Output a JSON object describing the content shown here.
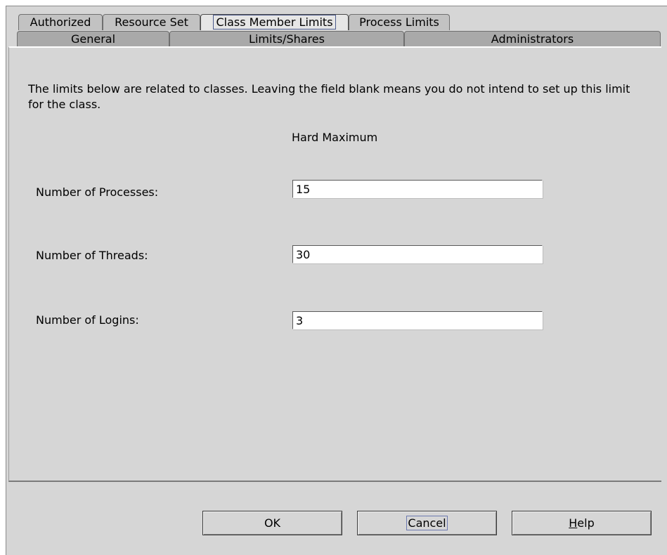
{
  "tabs_row1": [
    "Authorized",
    "Resource Set",
    "Class Member Limits",
    "Process Limits"
  ],
  "tabs_row2": [
    "General",
    "Limits/Shares",
    "Administrators"
  ],
  "selected_tab": "Class Member Limits",
  "description": "The limits below are related to classes. Leaving the field blank means you do not intend to set up this limit for the class.",
  "column_header": "Hard Maximum",
  "fields": {
    "processes": {
      "label": "Number of Processes:",
      "value": "15"
    },
    "threads": {
      "label": "Number of Threads:",
      "value": "30"
    },
    "logins": {
      "label": "Number of Logins:",
      "value": "3"
    }
  },
  "buttons": {
    "ok": "OK",
    "cancel": "Cancel",
    "help_mnemonic": "H",
    "help_rest": "elp"
  }
}
